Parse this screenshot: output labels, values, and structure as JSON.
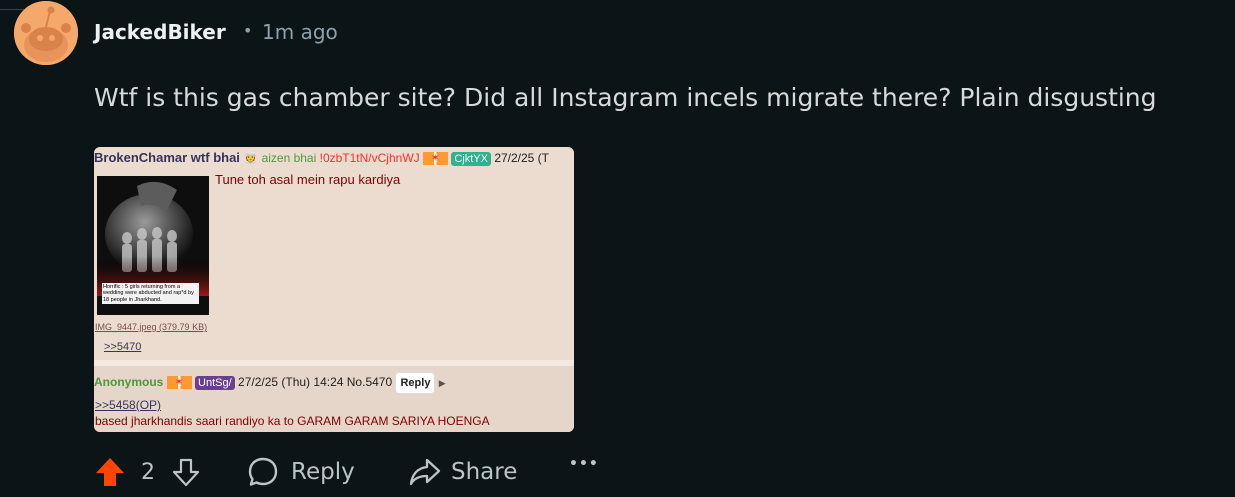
{
  "comment": {
    "username": "JackedBiker",
    "separator": "•",
    "timestamp": "1m ago",
    "body": "Wtf is this gas chamber site? Did all Instagram incels migrate there? Plain disgusting"
  },
  "embed": {
    "post1": {
      "name": "BrokenChamar wtf bhai",
      "subject": "aizen bhai",
      "tripcode": "!0zbT1tN/vCjhnWJ",
      "id": "CjktYX",
      "date": "27/2/25 (T",
      "text": "Tune toh asal mein rapu kardiya",
      "thumb_caption": "Horrific : 5 girls returning from a wedding were abducted and rap*d by 18 people in Jharkhand.",
      "file_info": "IMG_9447.jpeg (379.79 KB)",
      "backlink": ">>5470"
    },
    "post2": {
      "name": "Anonymous",
      "id": "UntSg/",
      "date": "27/2/25 (Thu) 14:24",
      "post_no": "No.5470",
      "reply_label": "Reply",
      "caret": "▶",
      "quote": ">>5458(OP)",
      "text": "based jharkhandis saari randiyo ka to GARAM GARAM SARIYA HOENGA"
    }
  },
  "actions": {
    "vote_count": "2",
    "reply_label": "Reply",
    "share_label": "Share",
    "more_label": "•••"
  },
  "colors": {
    "background": "#0b1416",
    "upvote_active": "#ff4500",
    "text_muted": "#8ba2ad"
  }
}
